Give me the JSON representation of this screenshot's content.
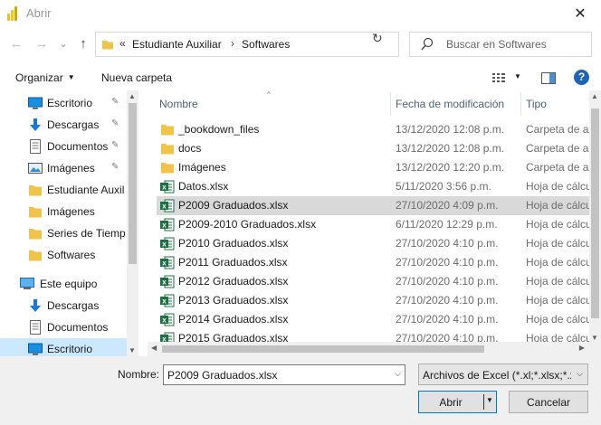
{
  "window": {
    "title": "Abrir",
    "close": "✕"
  },
  "nav": {
    "back": "←",
    "forward": "→",
    "recent": "⌄",
    "up": "↑",
    "overflow": "«",
    "breadcrumbs": [
      "Estudiante Auxiliar",
      "Softwares"
    ],
    "separator": "›",
    "refresh": "↻",
    "search_placeholder": "Buscar en Softwares"
  },
  "toolbar": {
    "organize": "Organizar",
    "new_folder": "Nueva carpeta",
    "help": "?",
    "colors": {
      "help_bg": "#1f64b5"
    }
  },
  "sidebar": {
    "items": [
      {
        "label": "Escritorio",
        "icon": "desktop-icon",
        "pinned": true
      },
      {
        "label": "Descargas",
        "icon": "download-icon",
        "pinned": true
      },
      {
        "label": "Documentos",
        "icon": "documents-icon",
        "pinned": true
      },
      {
        "label": "Imágenes",
        "icon": "pictures-icon",
        "pinned": true
      },
      {
        "label": "Estudiante Auxil",
        "icon": "folder-icon",
        "pinned": false
      },
      {
        "label": "Imágenes",
        "icon": "folder-icon",
        "pinned": false
      },
      {
        "label": "Series de Tiempo",
        "icon": "folder-icon",
        "pinned": false
      },
      {
        "label": "Softwares",
        "icon": "folder-icon",
        "pinned": false
      },
      {
        "label": "Este equipo",
        "icon": "computer-icon",
        "pinned": false
      },
      {
        "label": "Descargas",
        "icon": "download-icon",
        "pinned": false
      },
      {
        "label": "Documentos",
        "icon": "documents-icon",
        "pinned": false
      },
      {
        "label": "Escritorio",
        "icon": "desktop-icon",
        "pinned": false
      }
    ],
    "pin_glyph": "📌"
  },
  "files": {
    "columns": {
      "name": "Nombre",
      "date": "Fecha de modificación",
      "type": "Tipo"
    },
    "rows": [
      {
        "name": "_bookdown_files",
        "date": "13/12/2020 12:08 p.m.",
        "type": "Carpeta de archivos",
        "kind": "folder"
      },
      {
        "name": "docs",
        "date": "13/12/2020 12:08 p.m.",
        "type": "Carpeta de archivos",
        "kind": "folder"
      },
      {
        "name": "Imágenes",
        "date": "13/12/2020 12:20 p.m.",
        "type": "Carpeta de archivos",
        "kind": "folder"
      },
      {
        "name": "Datos.xlsx",
        "date": "5/11/2020 3:56 p.m.",
        "type": "Hoja de cálculo",
        "kind": "excel"
      },
      {
        "name": "P2009 Graduados.xlsx",
        "date": "27/10/2020 4:09 p.m.",
        "type": "Hoja de cálculo",
        "kind": "excel",
        "selected": true
      },
      {
        "name": "P2009-2010 Graduados.xlsx",
        "date": "6/11/2020 12:29 p.m.",
        "type": "Hoja de cálculo",
        "kind": "excel"
      },
      {
        "name": "P2010 Graduados.xlsx",
        "date": "27/10/2020 4:10 p.m.",
        "type": "Hoja de cálculo",
        "kind": "excel"
      },
      {
        "name": "P2011 Graduados.xlsx",
        "date": "27/10/2020 4:10 p.m.",
        "type": "Hoja de cálculo",
        "kind": "excel"
      },
      {
        "name": "P2012 Graduados.xlsx",
        "date": "27/10/2020 4:10 p.m.",
        "type": "Hoja de cálculo",
        "kind": "excel"
      },
      {
        "name": "P2013 Graduados.xlsx",
        "date": "27/10/2020 4:10 p.m.",
        "type": "Hoja de cálculo",
        "kind": "excel"
      },
      {
        "name": "P2014 Graduados.xlsx",
        "date": "27/10/2020 4:10 p.m.",
        "type": "Hoja de cálculo",
        "kind": "excel"
      },
      {
        "name": "P2015 Graduados.xlsx",
        "date": "27/10/2020 4:10 p.m.",
        "type": "Hoja de cálculo",
        "kind": "excel"
      }
    ]
  },
  "footer": {
    "name_label": "Nombre:",
    "name_value": "P2009 Graduados.xlsx",
    "filter_value": "Archivos de Excel (*.xl;*.xlsx;*.xlsm;*.xls)",
    "open": "Abrir",
    "cancel": "Cancelar"
  },
  "colors": {
    "accent": "#0078d7",
    "folder": "#f0c34a",
    "excel": "#1d7044",
    "selected_row": "#d9d9d9",
    "selected_nav": "#cce8ff"
  }
}
